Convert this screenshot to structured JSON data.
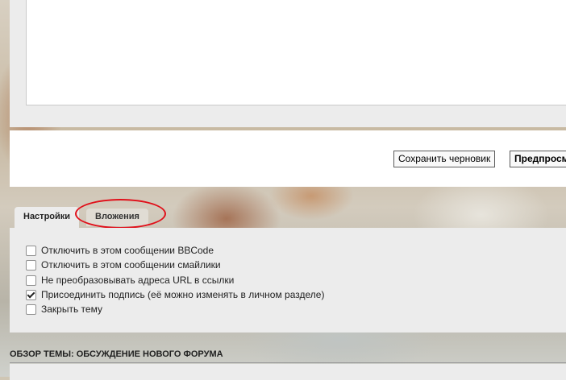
{
  "buttons": {
    "save_draft": "Сохранить черновик",
    "preview": "Предпросмотр"
  },
  "tabs": [
    {
      "label": "Настройки",
      "active": true
    },
    {
      "label": "Вложения",
      "active": false,
      "highlighted": true
    }
  ],
  "options": [
    {
      "label": "Отключить в этом сообщении BBCode",
      "checked": false
    },
    {
      "label": "Отключить в этом сообщении смайлики",
      "checked": false
    },
    {
      "label": "Не преобразовывать адреса URL в ссылки",
      "checked": false
    },
    {
      "label": "Присоединить подпись (её можно изменять в личном разделе)",
      "checked": true
    },
    {
      "label": "Закрыть тему",
      "checked": false
    }
  ],
  "review": {
    "title": "ОБЗОР ТЕМЫ: ОБСУЖДЕНИЕ НОВОГО ФОРУМА"
  },
  "colors": {
    "highlight": "#e0101a",
    "panel": "#ececec"
  }
}
